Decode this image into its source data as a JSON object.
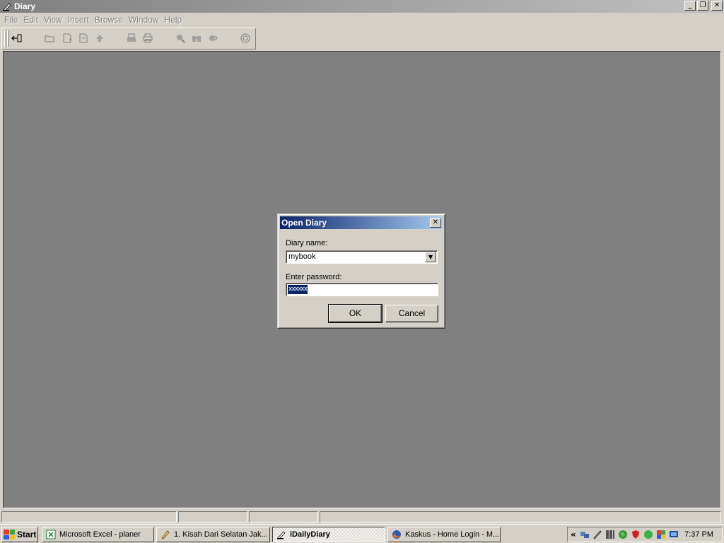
{
  "window": {
    "title": "Diary"
  },
  "menu": [
    "File",
    "Edit",
    "View",
    "Insert",
    "Browse",
    "Window",
    "Help"
  ],
  "dialog": {
    "title": "Open Diary",
    "diary_name_label": "Diary name:",
    "diary_name_value": "mybook",
    "password_label": "Enter password:",
    "password_mask": "xxxxxx",
    "ok_label": "OK",
    "cancel_label": "Cancel"
  },
  "taskbar": {
    "start_label": "Start",
    "tasks": [
      {
        "label": "Microsoft Excel - planer",
        "icon": "excel-icon"
      },
      {
        "label": "1. Kisah Dari Selatan Jak...",
        "icon": "document-icon"
      },
      {
        "label": "iDailyDiary",
        "icon": "diary-icon"
      },
      {
        "label": "Kaskus - Home Login - M...",
        "icon": "firefox-icon"
      }
    ],
    "clock": "7:37 PM"
  },
  "colors": {
    "face": "#d4d0c8",
    "workspace": "#808080",
    "dialog_title_start": "#0a246a",
    "dialog_title_end": "#a6caf0"
  }
}
